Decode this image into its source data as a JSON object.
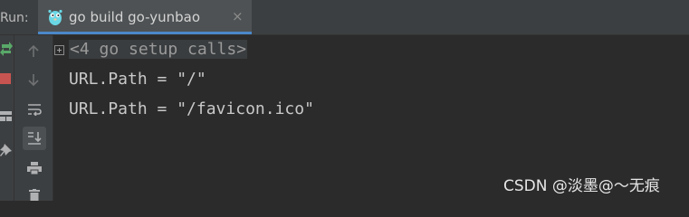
{
  "header": {
    "run_label": "Run:",
    "tab": {
      "label": "go build go-yunbao",
      "icon": "gopher-icon",
      "close": "×"
    }
  },
  "toolbar": {
    "outer_icons": [
      "rerun-icon",
      "stop-icon",
      "layout-icon",
      "pin-icon"
    ],
    "inner_icons": [
      "up-arrow-icon",
      "down-arrow-icon",
      "soft-wrap-icon",
      "scroll-to-end-icon",
      "print-icon",
      "trash-icon"
    ]
  },
  "console": {
    "folded": "<4 go setup calls>",
    "lines": [
      "URL.Path = \"/\"",
      "URL.Path = \"/favicon.ico\""
    ]
  },
  "watermark": "CSDN @淡墨@～无痕",
  "colors": {
    "background": "#2b2b2b",
    "panel": "#3c3f41",
    "tab_active": "#4e5254",
    "tab_underline": "#4a88c7",
    "text": "#c9c9c9",
    "stop_red": "#c75450",
    "rerun_green": "#59a869"
  }
}
